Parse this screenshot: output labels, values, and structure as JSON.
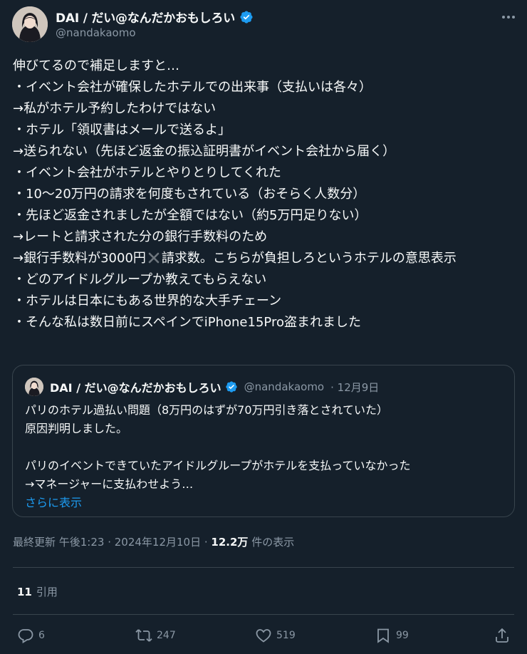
{
  "author": {
    "name": "DAI / だい@なんだかおもしろい",
    "handle": "@nandakaomo",
    "verified": true
  },
  "tweet_lines": [
    "伸びてるので補足しますと…",
    "・イベント会社が確保したホテルでの出来事（支払いは各々）",
    "→私がホテル予約したわけではない",
    "・ホテル「領収書はメールで送るよ」",
    "→送られない（先ほど返金の振込証明書がイベント会社から届く）",
    "・イベント会社がホテルとやりとりしてくれた",
    "・10～20万円の請求を何度もされている（おそらく人数分）",
    "・先ほど返金されましたが全額ではない（約5万円足りない）",
    "→レートと請求された分の銀行手数料のため"
  ],
  "tweet_line_bank_pre": "→銀行手数料が3000円",
  "tweet_line_bank_post": "請求数。こちらが負担しろというホテルの意思表示",
  "tweet_lines_after": [
    "・どのアイドルグループか教えてもらえない",
    "・ホテルは日本にもある世界的な大手チェーン",
    "・そんな私は数日前にスペインでiPhone15Pro盗まれました"
  ],
  "quote": {
    "name": "DAI / だい@なんだかおもしろい",
    "handle": "@nandakaomo",
    "date": "· 12月9日",
    "lines": [
      "パリのホテル過払い問題（8万円のはずが70万円引き落とされていた）",
      "原因判明しました。",
      "",
      "パリのイベントできていたアイドルグループがホテルを支払っていなかった",
      "→マネージャーに支払わせよう…"
    ],
    "show_more": "さらに表示"
  },
  "meta": {
    "prefix": "最終更新 午後1:23 · 2024年12月10日 · ",
    "views": "12.2万",
    "views_label": " 件の表示"
  },
  "quotes_count": "11",
  "quotes_label": "引用",
  "actions": {
    "replies": "6",
    "reposts": "247",
    "likes": "519",
    "bookmarks": "99"
  },
  "colors": {
    "background": "#15202b",
    "text": "#f7f9f9",
    "muted": "#8b98a5",
    "accent": "#1d9bf0",
    "border": "#38444d"
  },
  "icons": [
    "verified-badge-icon",
    "more-icon",
    "reply-icon",
    "repost-icon",
    "like-icon",
    "bookmark-icon",
    "share-icon",
    "cross-mark-icon"
  ]
}
